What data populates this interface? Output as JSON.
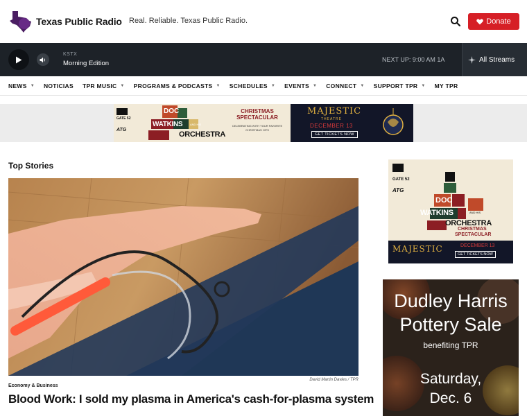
{
  "header": {
    "logo_text": "Texas Public Radio",
    "tagline": "Real. Reliable. Texas Public Radio.",
    "donate_label": "Donate"
  },
  "player": {
    "station": "KSTX",
    "program": "Morning Edition",
    "next_up": "NEXT UP: 9:00 AM 1A",
    "streams_label": "All Streams"
  },
  "nav": {
    "items": [
      {
        "label": "NEWS",
        "dropdown": true
      },
      {
        "label": "NOTICIAS",
        "dropdown": false
      },
      {
        "label": "TPR MUSIC",
        "dropdown": true
      },
      {
        "label": "PROGRAMS & PODCASTS",
        "dropdown": true
      },
      {
        "label": "SCHEDULES",
        "dropdown": true
      },
      {
        "label": "EVENTS",
        "dropdown": true
      },
      {
        "label": "CONNECT",
        "dropdown": true
      },
      {
        "label": "SUPPORT TPR",
        "dropdown": true
      },
      {
        "label": "MY TPR",
        "dropdown": false
      }
    ]
  },
  "banner_ad": {
    "venue_logo": "GATE 52",
    "sponsor_logo": "ATG",
    "title_doc": "DOC",
    "title_watkins": "WATKINS",
    "title_and_his": "AND HIS",
    "title_orchestra": "ORCHESTRA",
    "event": "CHRISTMAS SPECTACULAR",
    "tagline": "CELEBRATING WITH YOUR FAVORITE CHRISTMAS HITS",
    "theater": "MAJESTIC",
    "theater_sub": "THEATRE",
    "date": "DECEMBER 13",
    "cta": "GET TICKETS NOW"
  },
  "main": {
    "section_title": "Top Stories",
    "hero_credit": "David Martin Davies  /  TPR",
    "category": "Economy & Business",
    "headline": "Blood Work: I sold my plasma in America's cash-for-plasma system"
  },
  "side_ad1": {
    "venue_logo": "GATE 52",
    "sponsor_logo": "ATG",
    "title_doc": "DOC",
    "title_watkins": "WATKINS",
    "title_and_his": "AND HIS",
    "title_orchestra": "ORCHESTRA",
    "event_line1": "CHRISTMAS",
    "event_line2": "SPECTACULAR",
    "theater": "MAJESTIC",
    "date": "DECEMBER 13",
    "cta": "GET TICKETS NOW"
  },
  "side_ad2": {
    "line1": "Dudley Harris",
    "line2": "Pottery Sale",
    "sub": "benefiting TPR",
    "day": "Saturday,",
    "date": "Dec. 6"
  },
  "colors": {
    "donate": "#d61f26",
    "player_bg": "#1d2228",
    "logo_purple": "#4b1e63"
  }
}
